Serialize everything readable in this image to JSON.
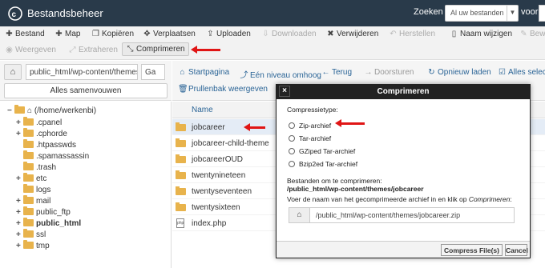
{
  "header": {
    "title": "Bestandsbeheer",
    "search_label": "Zoeken",
    "search_scope": "Al uw bestanden",
    "search_for": "voor",
    "accent_color": "#293a4a"
  },
  "toolbar": {
    "row1": [
      {
        "label": "Bestand",
        "icon": "plus-icon"
      },
      {
        "label": "Map",
        "icon": "plus-icon"
      },
      {
        "label": "Kopiëren",
        "icon": "copy-icon"
      },
      {
        "label": "Verplaatsen",
        "icon": "move-icon"
      },
      {
        "label": "Uploaden",
        "icon": "upload-icon"
      },
      {
        "label": "Downloaden",
        "icon": "download-icon"
      },
      {
        "label": "Verwijderen",
        "icon": "close-icon"
      },
      {
        "label": "Herstellen",
        "icon": "undo-icon"
      },
      {
        "label": "Naam wijzigen",
        "icon": "file-icon"
      },
      {
        "label": "Bewe",
        "icon": "pencil-icon"
      }
    ],
    "row2": [
      {
        "label": "Weergeven",
        "icon": "eye-icon"
      },
      {
        "label": "Extraheren",
        "icon": "expand-icon"
      },
      {
        "label": "Comprimeren",
        "icon": "compress-icon"
      }
    ]
  },
  "left": {
    "path_value": "public_html/wp-content/themes/jobcareer",
    "go_label": "Ga",
    "collapse_label": "Alles samenvouwen",
    "root": "(/home/werkenbi)",
    "tree": [
      ".cpanel",
      ".cphorde",
      ".htpasswds",
      ".spamassassin",
      ".trash",
      "etc",
      "logs",
      "mail",
      "public_ftp",
      "public_html",
      "ssl",
      "tmp"
    ]
  },
  "nav": {
    "home": "Startpagina",
    "up": "Eén niveau omhoog",
    "back": "Terug",
    "forward": "Doorsturen",
    "reload": "Opnieuw laden",
    "select_all": "Alles selec",
    "trash": "Prullenbak weergeven"
  },
  "files": {
    "header": "Name",
    "rows": [
      "jobcareer",
      "jobcareer-child-theme",
      "jobcareerOUD",
      "twentynineteen",
      "twentyseventeen",
      "twentysixteen",
      "index.php"
    ]
  },
  "modal": {
    "title": "Comprimeren",
    "type_label": "Compressietype:",
    "options": [
      "Zip-archief",
      "Tar-archief",
      "GZiped Tar-archief",
      "Bzip2ed Tar-archief"
    ],
    "files_label": "Bestanden om te comprimeren:",
    "files_value": "/public_html/wp-content/themes/jobcareer",
    "name_prompt": "Voer de naam van het gecomprimeerde archief in en klik op",
    "name_prompt_em": "Comprimeren",
    "name_prompt_end": ":",
    "archive_value": "/public_html/wp-content/themes/jobcareer.zip",
    "compress_button": "Compress File(s)",
    "cancel_button": "Cancel",
    "close_glyph": "×"
  }
}
